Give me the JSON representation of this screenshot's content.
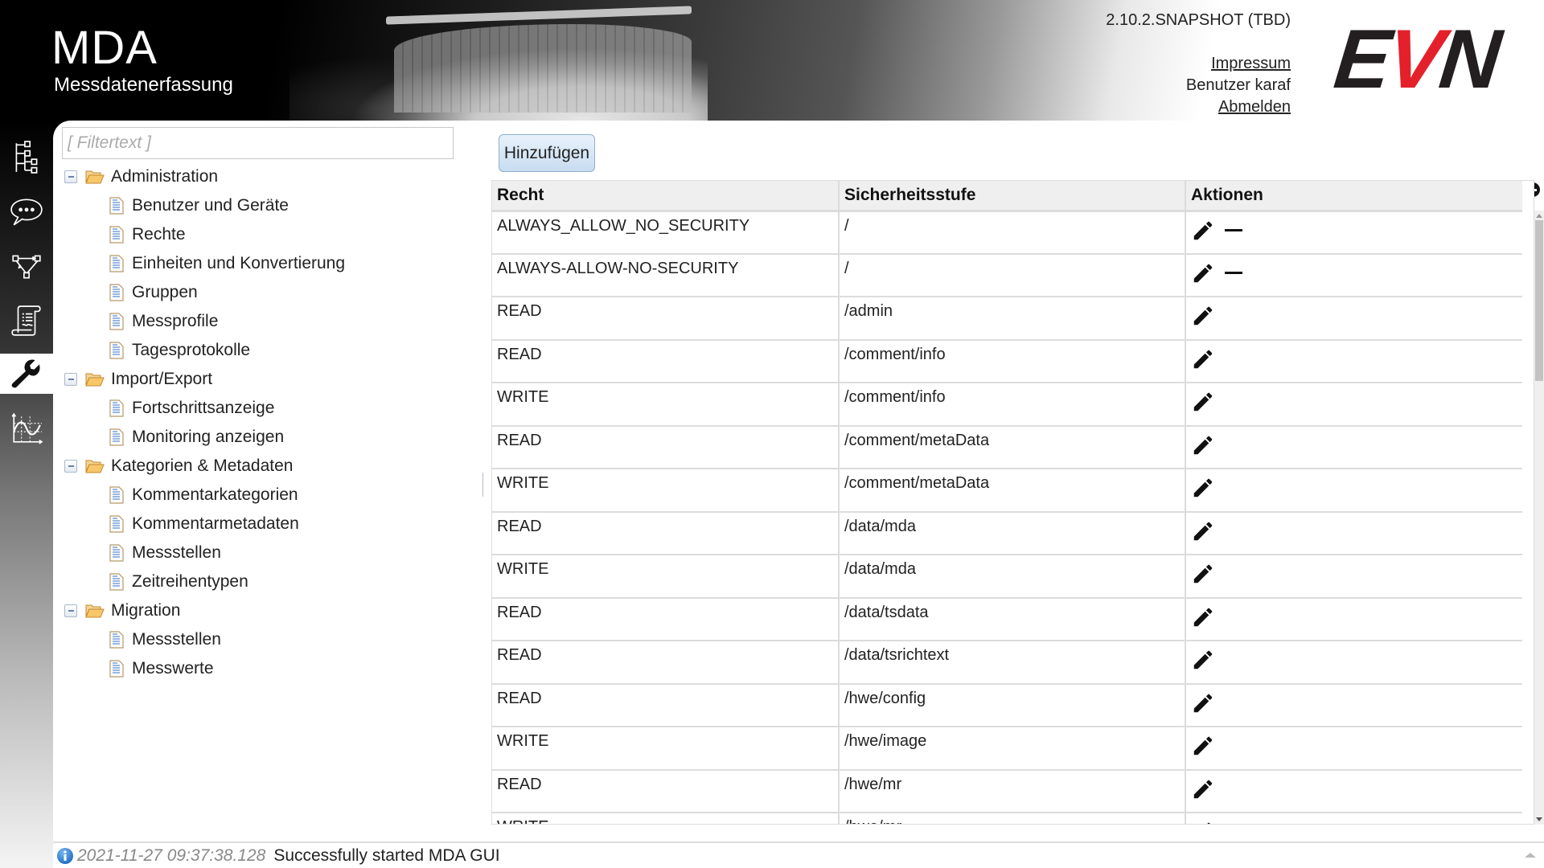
{
  "header": {
    "app_title": "MDA",
    "app_subtitle": "Messdatenerfassung",
    "version": "2.10.2.SNAPSHOT (TBD)",
    "impressum_label": "Impressum",
    "user_label": "Benutzer karaf",
    "logout_label": "Abmelden",
    "logo": {
      "e": "E",
      "v": "V",
      "n": "N",
      "brand_red": "#e4202a",
      "brand_dark": "#231f20"
    }
  },
  "rail": {
    "items": [
      {
        "icon": "hierarchy-tree-icon",
        "active": false
      },
      {
        "icon": "speech-bubble-icon",
        "active": false
      },
      {
        "icon": "workflow-graph-icon",
        "active": false
      },
      {
        "icon": "scroll-document-icon",
        "active": false
      },
      {
        "icon": "wrench-icon",
        "active": true
      },
      {
        "icon": "chart-curve-icon",
        "active": false
      }
    ]
  },
  "tree": {
    "filter_placeholder": "[ Filtertext ]",
    "filter_value": "",
    "groups": [
      {
        "label": "Administration",
        "expanded": true,
        "children": [
          "Benutzer und Geräte",
          "Rechte",
          "Einheiten und Konvertierung",
          "Gruppen",
          "Messprofile",
          "Tagesprotokolle"
        ]
      },
      {
        "label": "Import/Export",
        "expanded": true,
        "children": [
          "Fortschrittsanzeige",
          "Monitoring anzeigen"
        ]
      },
      {
        "label": "Kategorien & Metadaten",
        "expanded": true,
        "children": [
          "Kommentarkategorien",
          "Kommentarmetadaten",
          "Messstellen",
          "Zeitreihentypen"
        ]
      },
      {
        "label": "Migration",
        "expanded": true,
        "children": [
          "Messstellen",
          "Messwerte"
        ]
      }
    ]
  },
  "main": {
    "add_button_label": "Hinzufügen",
    "table": {
      "columns": [
        "Recht",
        "Sicherheitsstufe",
        "Aktionen"
      ],
      "rows": [
        {
          "recht": "ALWAYS_ALLOW_NO_SECURITY",
          "stufe": "/",
          "deletable": true
        },
        {
          "recht": "ALWAYS-ALLOW-NO-SECURITY",
          "stufe": "/",
          "deletable": true
        },
        {
          "recht": "READ",
          "stufe": "/admin",
          "deletable": false
        },
        {
          "recht": "READ",
          "stufe": "/comment/info",
          "deletable": false
        },
        {
          "recht": "WRITE",
          "stufe": "/comment/info",
          "deletable": false
        },
        {
          "recht": "READ",
          "stufe": "/comment/metaData",
          "deletable": false
        },
        {
          "recht": "WRITE",
          "stufe": "/comment/metaData",
          "deletable": false
        },
        {
          "recht": "READ",
          "stufe": "/data/mda",
          "deletable": false
        },
        {
          "recht": "WRITE",
          "stufe": "/data/mda",
          "deletable": false
        },
        {
          "recht": "READ",
          "stufe": "/data/tsdata",
          "deletable": false
        },
        {
          "recht": "READ",
          "stufe": "/data/tsrichtext",
          "deletable": false
        },
        {
          "recht": "READ",
          "stufe": "/hwe/config",
          "deletable": false
        },
        {
          "recht": "WRITE",
          "stufe": "/hwe/image",
          "deletable": false
        },
        {
          "recht": "READ",
          "stufe": "/hwe/mr",
          "deletable": false
        },
        {
          "recht": "WRITE",
          "stufe": "/hwe/mr",
          "deletable": false
        }
      ]
    }
  },
  "status": {
    "timestamp": "2021-11-27 09:37:38.128",
    "message": "Successfully started MDA GUI"
  }
}
